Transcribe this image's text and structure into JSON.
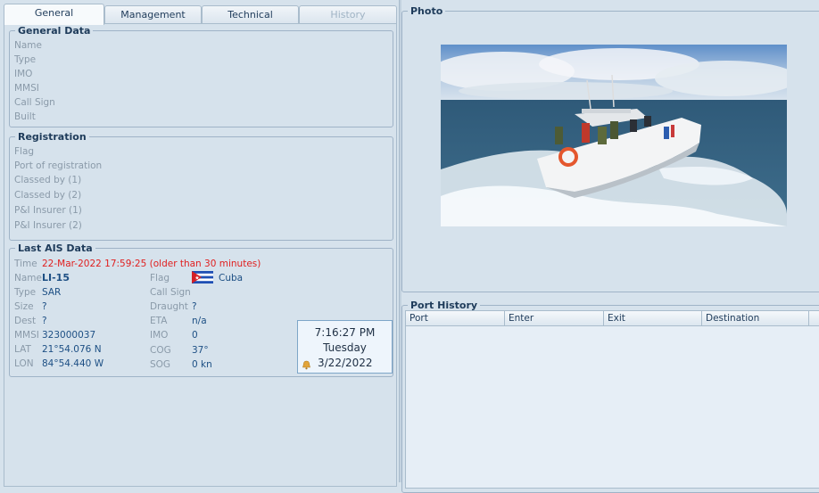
{
  "tabs": [
    {
      "label": "General",
      "state": "active"
    },
    {
      "label": "Management",
      "state": "normal"
    },
    {
      "label": "Technical",
      "state": "normal"
    },
    {
      "label": "History",
      "state": "disabled"
    }
  ],
  "general_data": {
    "title": "General Data",
    "labels": [
      "Name",
      "Type",
      "IMO",
      "MMSI",
      "Call Sign",
      "Built"
    ]
  },
  "registration": {
    "title": "Registration",
    "labels": [
      "Flag",
      "Port of registration",
      "Classed by (1)",
      "Classed by (2)",
      "P&I Insurer (1)",
      "P&I Insurer (2)"
    ]
  },
  "ais": {
    "title": "Last AIS Data",
    "time_label": "Time",
    "time_value": "22-Mar-2022 17:59:25 (older than 30 minutes)",
    "name_label": "Name",
    "name_value": "LI-15",
    "type_label": "Type",
    "type_value": "SAR",
    "size_label": "Size",
    "size_value": "?",
    "dest_label": "Dest",
    "dest_value": "?",
    "mmsi_label": "MMSI",
    "mmsi_value": "323000037",
    "lat_label": "LAT",
    "lat_value": "21°54.076 N",
    "lon_label": "LON",
    "lon_value": "84°54.440 W",
    "flag_label": "Flag",
    "flag_value": "Cuba",
    "callsign_label": "Call Sign",
    "draught_label": "Draught",
    "draught_value": "?",
    "eta_label": "ETA",
    "eta_value": "n/a",
    "imo_label": "IMO",
    "imo_value": "0",
    "cog_label": "COG",
    "cog_value": "37°",
    "sog_label": "SOG",
    "sog_value": "0 kn"
  },
  "clock": {
    "time": "7:16:27 PM",
    "day": "Tuesday",
    "date": "3/22/2022"
  },
  "photo": {
    "title": "Photo"
  },
  "port_history": {
    "title": "Port History",
    "columns": [
      "Port",
      "Enter",
      "Exit",
      "Destination"
    ]
  },
  "colors": {
    "accent": "#1d4f84",
    "warning": "#e02020",
    "label": "#8a9aa9"
  }
}
